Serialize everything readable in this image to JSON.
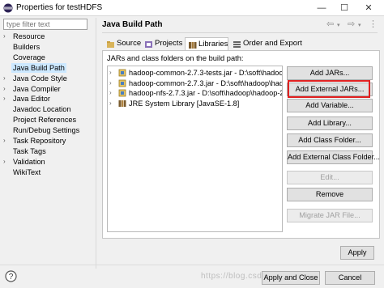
{
  "window": {
    "title": "Properties for testHDFS",
    "minimize": "—",
    "maximize": "☐",
    "close": "✕"
  },
  "filter": {
    "placeholder": "type filter text"
  },
  "nav": {
    "items": [
      {
        "label": "Resource",
        "expandable": true
      },
      {
        "label": "Builders",
        "expandable": false
      },
      {
        "label": "Coverage",
        "expandable": false
      },
      {
        "label": "Java Build Path",
        "expandable": false,
        "selected": true
      },
      {
        "label": "Java Code Style",
        "expandable": true
      },
      {
        "label": "Java Compiler",
        "expandable": true
      },
      {
        "label": "Java Editor",
        "expandable": true
      },
      {
        "label": "Javadoc Location",
        "expandable": false
      },
      {
        "label": "Project References",
        "expandable": false
      },
      {
        "label": "Run/Debug Settings",
        "expandable": false
      },
      {
        "label": "Task Repository",
        "expandable": true
      },
      {
        "label": "Task Tags",
        "expandable": false
      },
      {
        "label": "Validation",
        "expandable": true
      },
      {
        "label": "WikiText",
        "expandable": false
      }
    ]
  },
  "page": {
    "title": "Java Build Path",
    "history": {
      "back": "⇦",
      "back_drop": "▾",
      "forward": "⇨",
      "forward_drop": "▾",
      "menu": "⋮"
    }
  },
  "tabs": [
    {
      "label": "Source",
      "icon": "source-folder-icon"
    },
    {
      "label": "Projects",
      "icon": "projects-icon"
    },
    {
      "label": "Libraries",
      "icon": "libraries-icon",
      "active": true
    },
    {
      "label": "Order and Export",
      "icon": "order-export-icon"
    }
  ],
  "libraries": {
    "caption": "JARs and class folders on the build path:",
    "entries": [
      {
        "label": "hadoop-common-2.7.3-tests.jar - D:\\soft\\hadoop\\",
        "icon": "jar-icon"
      },
      {
        "label": "hadoop-common-2.7.3.jar - D:\\soft\\hadoop\\hado",
        "icon": "jar-icon"
      },
      {
        "label": "hadoop-nfs-2.7.3.jar - D:\\soft\\hadoop\\hadoop-2.7",
        "icon": "jar-icon"
      },
      {
        "label": "JRE System Library [JavaSE-1.8]",
        "icon": "library-icon"
      }
    ]
  },
  "buttons": {
    "add_jars": "Add JARs...",
    "add_external_jars": "Add External JARs...",
    "add_variable": "Add Variable...",
    "add_library": "Add Library...",
    "add_class_folder": "Add Class Folder...",
    "add_external_class_folder": "Add External Class Folder...",
    "edit": "Edit...",
    "remove": "Remove",
    "migrate_jar": "Migrate JAR File...",
    "apply": "Apply",
    "apply_and_close": "Apply and Close",
    "cancel": "Cancel"
  },
  "watermark": "https://blog.csdn.net/u0...421",
  "colors": {
    "selection": "#cce8ff",
    "highlight_border": "#e02020",
    "button_face": "#e1e1e1"
  }
}
